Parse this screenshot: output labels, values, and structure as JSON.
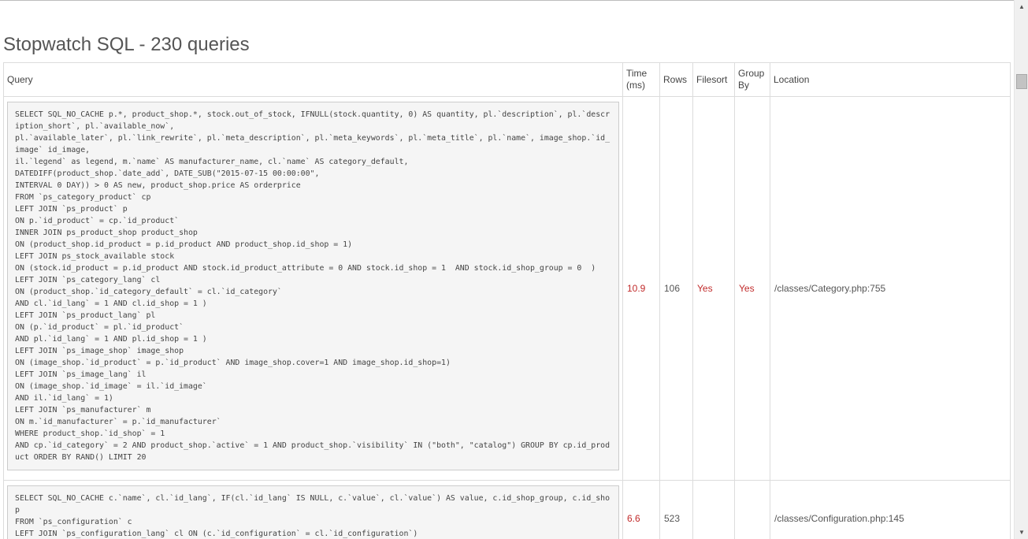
{
  "page": {
    "title": "Stopwatch SQL - 230 queries"
  },
  "table": {
    "headers": {
      "query": "Query",
      "time": "Time (ms)",
      "rows": "Rows",
      "filesort": "Filesort",
      "group_by": "Group By",
      "location": "Location"
    },
    "rows": [
      {
        "query": "SELECT SQL_NO_CACHE p.*, product_shop.*, stock.out_of_stock, IFNULL(stock.quantity, 0) AS quantity, pl.`description`, pl.`description_short`, pl.`available_now`,\npl.`available_later`, pl.`link_rewrite`, pl.`meta_description`, pl.`meta_keywords`, pl.`meta_title`, pl.`name`, image_shop.`id_image` id_image,\nil.`legend` as legend, m.`name` AS manufacturer_name, cl.`name` AS category_default,\nDATEDIFF(product_shop.`date_add`, DATE_SUB(\"2015-07-15 00:00:00\",\nINTERVAL 0 DAY)) > 0 AS new, product_shop.price AS orderprice\nFROM `ps_category_product` cp\nLEFT JOIN `ps_product` p\nON p.`id_product` = cp.`id_product`\nINNER JOIN ps_product_shop product_shop\nON (product_shop.id_product = p.id_product AND product_shop.id_shop = 1)\nLEFT JOIN ps_stock_available stock\nON (stock.id_product = p.id_product AND stock.id_product_attribute = 0 AND stock.id_shop = 1  AND stock.id_shop_group = 0  )\nLEFT JOIN `ps_category_lang` cl\nON (product_shop.`id_category_default` = cl.`id_category`\nAND cl.`id_lang` = 1 AND cl.id_shop = 1 )\nLEFT JOIN `ps_product_lang` pl\nON (p.`id_product` = pl.`id_product`\nAND pl.`id_lang` = 1 AND pl.id_shop = 1 )\nLEFT JOIN `ps_image_shop` image_shop\nON (image_shop.`id_product` = p.`id_product` AND image_shop.cover=1 AND image_shop.id_shop=1)\nLEFT JOIN `ps_image_lang` il\nON (image_shop.`id_image` = il.`id_image`\nAND il.`id_lang` = 1)\nLEFT JOIN `ps_manufacturer` m\nON m.`id_manufacturer` = p.`id_manufacturer`\nWHERE product_shop.`id_shop` = 1\nAND cp.`id_category` = 2 AND product_shop.`active` = 1 AND product_shop.`visibility` IN (\"both\", \"catalog\") GROUP BY cp.id_product ORDER BY RAND() LIMIT 20",
        "time": "10.9",
        "rows": "106",
        "filesort": "Yes",
        "group_by": "Yes",
        "location": "/classes/Category.php:755"
      },
      {
        "query": "SELECT SQL_NO_CACHE c.`name`, cl.`id_lang`, IF(cl.`id_lang` IS NULL, c.`value`, cl.`value`) AS value, c.id_shop_group, c.id_shop\nFROM `ps_configuration` c\nLEFT JOIN `ps_configuration_lang` cl ON (c.`id_configuration` = cl.`id_configuration`)",
        "time": "6.6",
        "rows": "523",
        "filesort": "",
        "group_by": "",
        "location": "/classes/Configuration.php:145"
      }
    ]
  },
  "scrollbar": {
    "up_icon": "triangle-up",
    "down_icon": "triangle-down"
  }
}
